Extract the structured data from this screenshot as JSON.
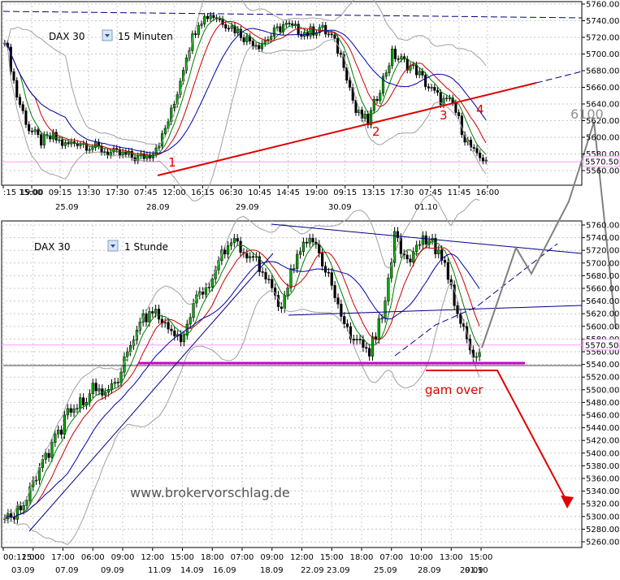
{
  "top_panel": {
    "symbol": "DAX 30",
    "timeframe": "15 Minuten",
    "price_label": "5570.50",
    "y_ticks": [
      "5760.00",
      "5740.00",
      "5720.00",
      "5700.00",
      "5680.00",
      "5660.00",
      "5640.00",
      "5620.00",
      "5600.00",
      "5580.00",
      "5560.00"
    ],
    "x_time_labels": [
      ":15 15:00",
      "19:00",
      "09:15",
      "13:30",
      "17:30",
      "07:45",
      "12:00",
      "16:15",
      "06:30",
      "10:45",
      "14:45",
      "19:00",
      "09:15",
      "13:15",
      "17:30",
      "07:45",
      "11:45",
      "16:00"
    ],
    "x_date_labels": [
      "25.09",
      "28.09",
      "29.09",
      "30.09",
      "01.10"
    ],
    "wave_labels": [
      "1",
      "2",
      "3",
      "4"
    ],
    "target_label": "6100"
  },
  "bottom_panel": {
    "symbol": "DAX 30",
    "timeframe": "1 Stunde",
    "price_label": "5570.50",
    "y_ticks": [
      "5760.00",
      "5740.00",
      "5720.00",
      "5700.00",
      "5680.00",
      "5660.00",
      "5640.00",
      "5620.00",
      "5600.00",
      "5580.00",
      "5560.00",
      "5540.00",
      "5520.00",
      "5500.00",
      "5480.00",
      "5460.00",
      "5440.00",
      "5420.00",
      "5400.00",
      "5380.00",
      "5360.00",
      "5340.00",
      "5320.00",
      "5300.00",
      "5280.00",
      "5260.00"
    ],
    "x_time_labels": [
      "00:12:00",
      "15:00",
      "17:00",
      "06:00",
      "09:00",
      "12:00",
      "15:00",
      "18:00",
      "07:00",
      "09:00",
      "12:00",
      "15:00",
      "18:00",
      "07:00",
      "10:00",
      "13:00",
      "15:00"
    ],
    "x_date_labels": [
      "03.09",
      "07.09",
      "09.09",
      "11.09",
      "14.09",
      "16.09",
      "18.09",
      "22.09",
      "23.09",
      "25.09",
      "28.09",
      "29.09",
      "01.10"
    ],
    "annotation": "gam over",
    "watermark": "www.brokervorschlag.de"
  },
  "colors": {
    "candle_up": "#00aa00",
    "candle_down": "#000000",
    "trendline_red": "#e00000",
    "support_magenta": "#cc00cc",
    "channel_blue": "#000080",
    "scenario_gray": "#808080",
    "price_line_pink": "#ff99ff"
  },
  "chart_data": [
    {
      "type": "candlestick",
      "title": "DAX 30 15 Minuten",
      "ylim": [
        5548,
        5768
      ],
      "approx_close_path": [
        5720,
        5650,
        5610,
        5595,
        5600,
        5590,
        5595,
        5590,
        5585,
        5580,
        5578,
        5575,
        5580,
        5600,
        5640,
        5700,
        5740,
        5748,
        5740,
        5730,
        5718,
        5712,
        5722,
        5735,
        5730,
        5725,
        5732,
        5720,
        5690,
        5630,
        5618,
        5660,
        5700,
        5690,
        5680,
        5660,
        5645,
        5640,
        5600,
        5575
      ],
      "annotations": [
        "1",
        "2",
        "3",
        "4",
        "6100"
      ],
      "current_price": 5570.5
    },
    {
      "type": "candlestick",
      "title": "DAX 30 1 Stunde",
      "ylim": [
        5255,
        5768
      ],
      "approx_close_path": [
        5290,
        5310,
        5340,
        5380,
        5420,
        5460,
        5480,
        5500,
        5490,
        5520,
        5580,
        5610,
        5620,
        5600,
        5580,
        5640,
        5660,
        5700,
        5740,
        5720,
        5700,
        5670,
        5630,
        5700,
        5740,
        5720,
        5660,
        5600,
        5580,
        5560,
        5620,
        5740,
        5700,
        5740,
        5730,
        5690,
        5620,
        5560
      ],
      "support_level": 5544,
      "annotation": "gam over",
      "current_price": 5570.5
    }
  ]
}
